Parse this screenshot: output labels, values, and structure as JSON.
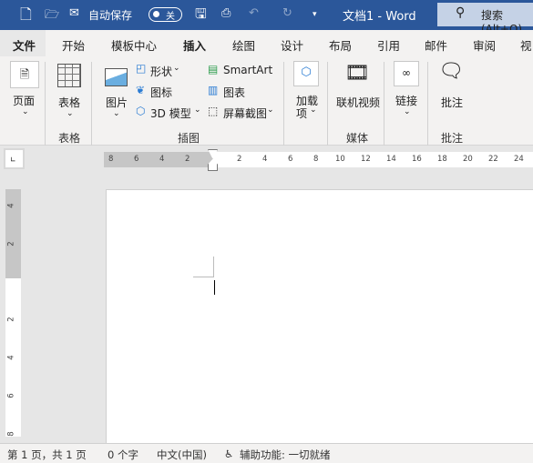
{
  "titlebar": {
    "autosave_label": "自动保存",
    "autosave_state": "关",
    "title": "文档1  -  Word",
    "search_placeholder": "搜索(Alt+Q)"
  },
  "tabs": [
    "文件",
    "开始",
    "模板中心",
    "插入",
    "绘图",
    "设计",
    "布局",
    "引用",
    "邮件",
    "审阅",
    "视"
  ],
  "active_tab": "插入",
  "ribbon": {
    "pages": "页面",
    "table": "表格",
    "pictures": "图片",
    "shapes": "形状",
    "icons": "图标",
    "models3d": "3D 模型",
    "smartart": "SmartArt",
    "chart": "图表",
    "screenshot": "屏幕截图",
    "addins_1": "加载",
    "addins_2": "项",
    "online_video": "联机视频",
    "link": "链接",
    "comment": "批注",
    "groups": {
      "table": "表格",
      "illustrations": "插图",
      "media": "媒体",
      "comments": "批注"
    }
  },
  "ruler": {
    "h_left": [
      "8",
      "6",
      "4",
      "2"
    ],
    "h_right": [
      "2",
      "4",
      "6",
      "8",
      "10",
      "12",
      "14",
      "16",
      "18",
      "20",
      "22",
      "24"
    ],
    "v_top": [
      "4",
      "2"
    ],
    "v_bottom": [
      "2",
      "4",
      "6",
      "8"
    ]
  },
  "status": {
    "page": "第 1 页，共 1 页",
    "words": "0 个字",
    "lang": "中文(中国)",
    "accessibility": "辅助功能: 一切就绪"
  },
  "colors": {
    "brand": "#2b579a"
  }
}
